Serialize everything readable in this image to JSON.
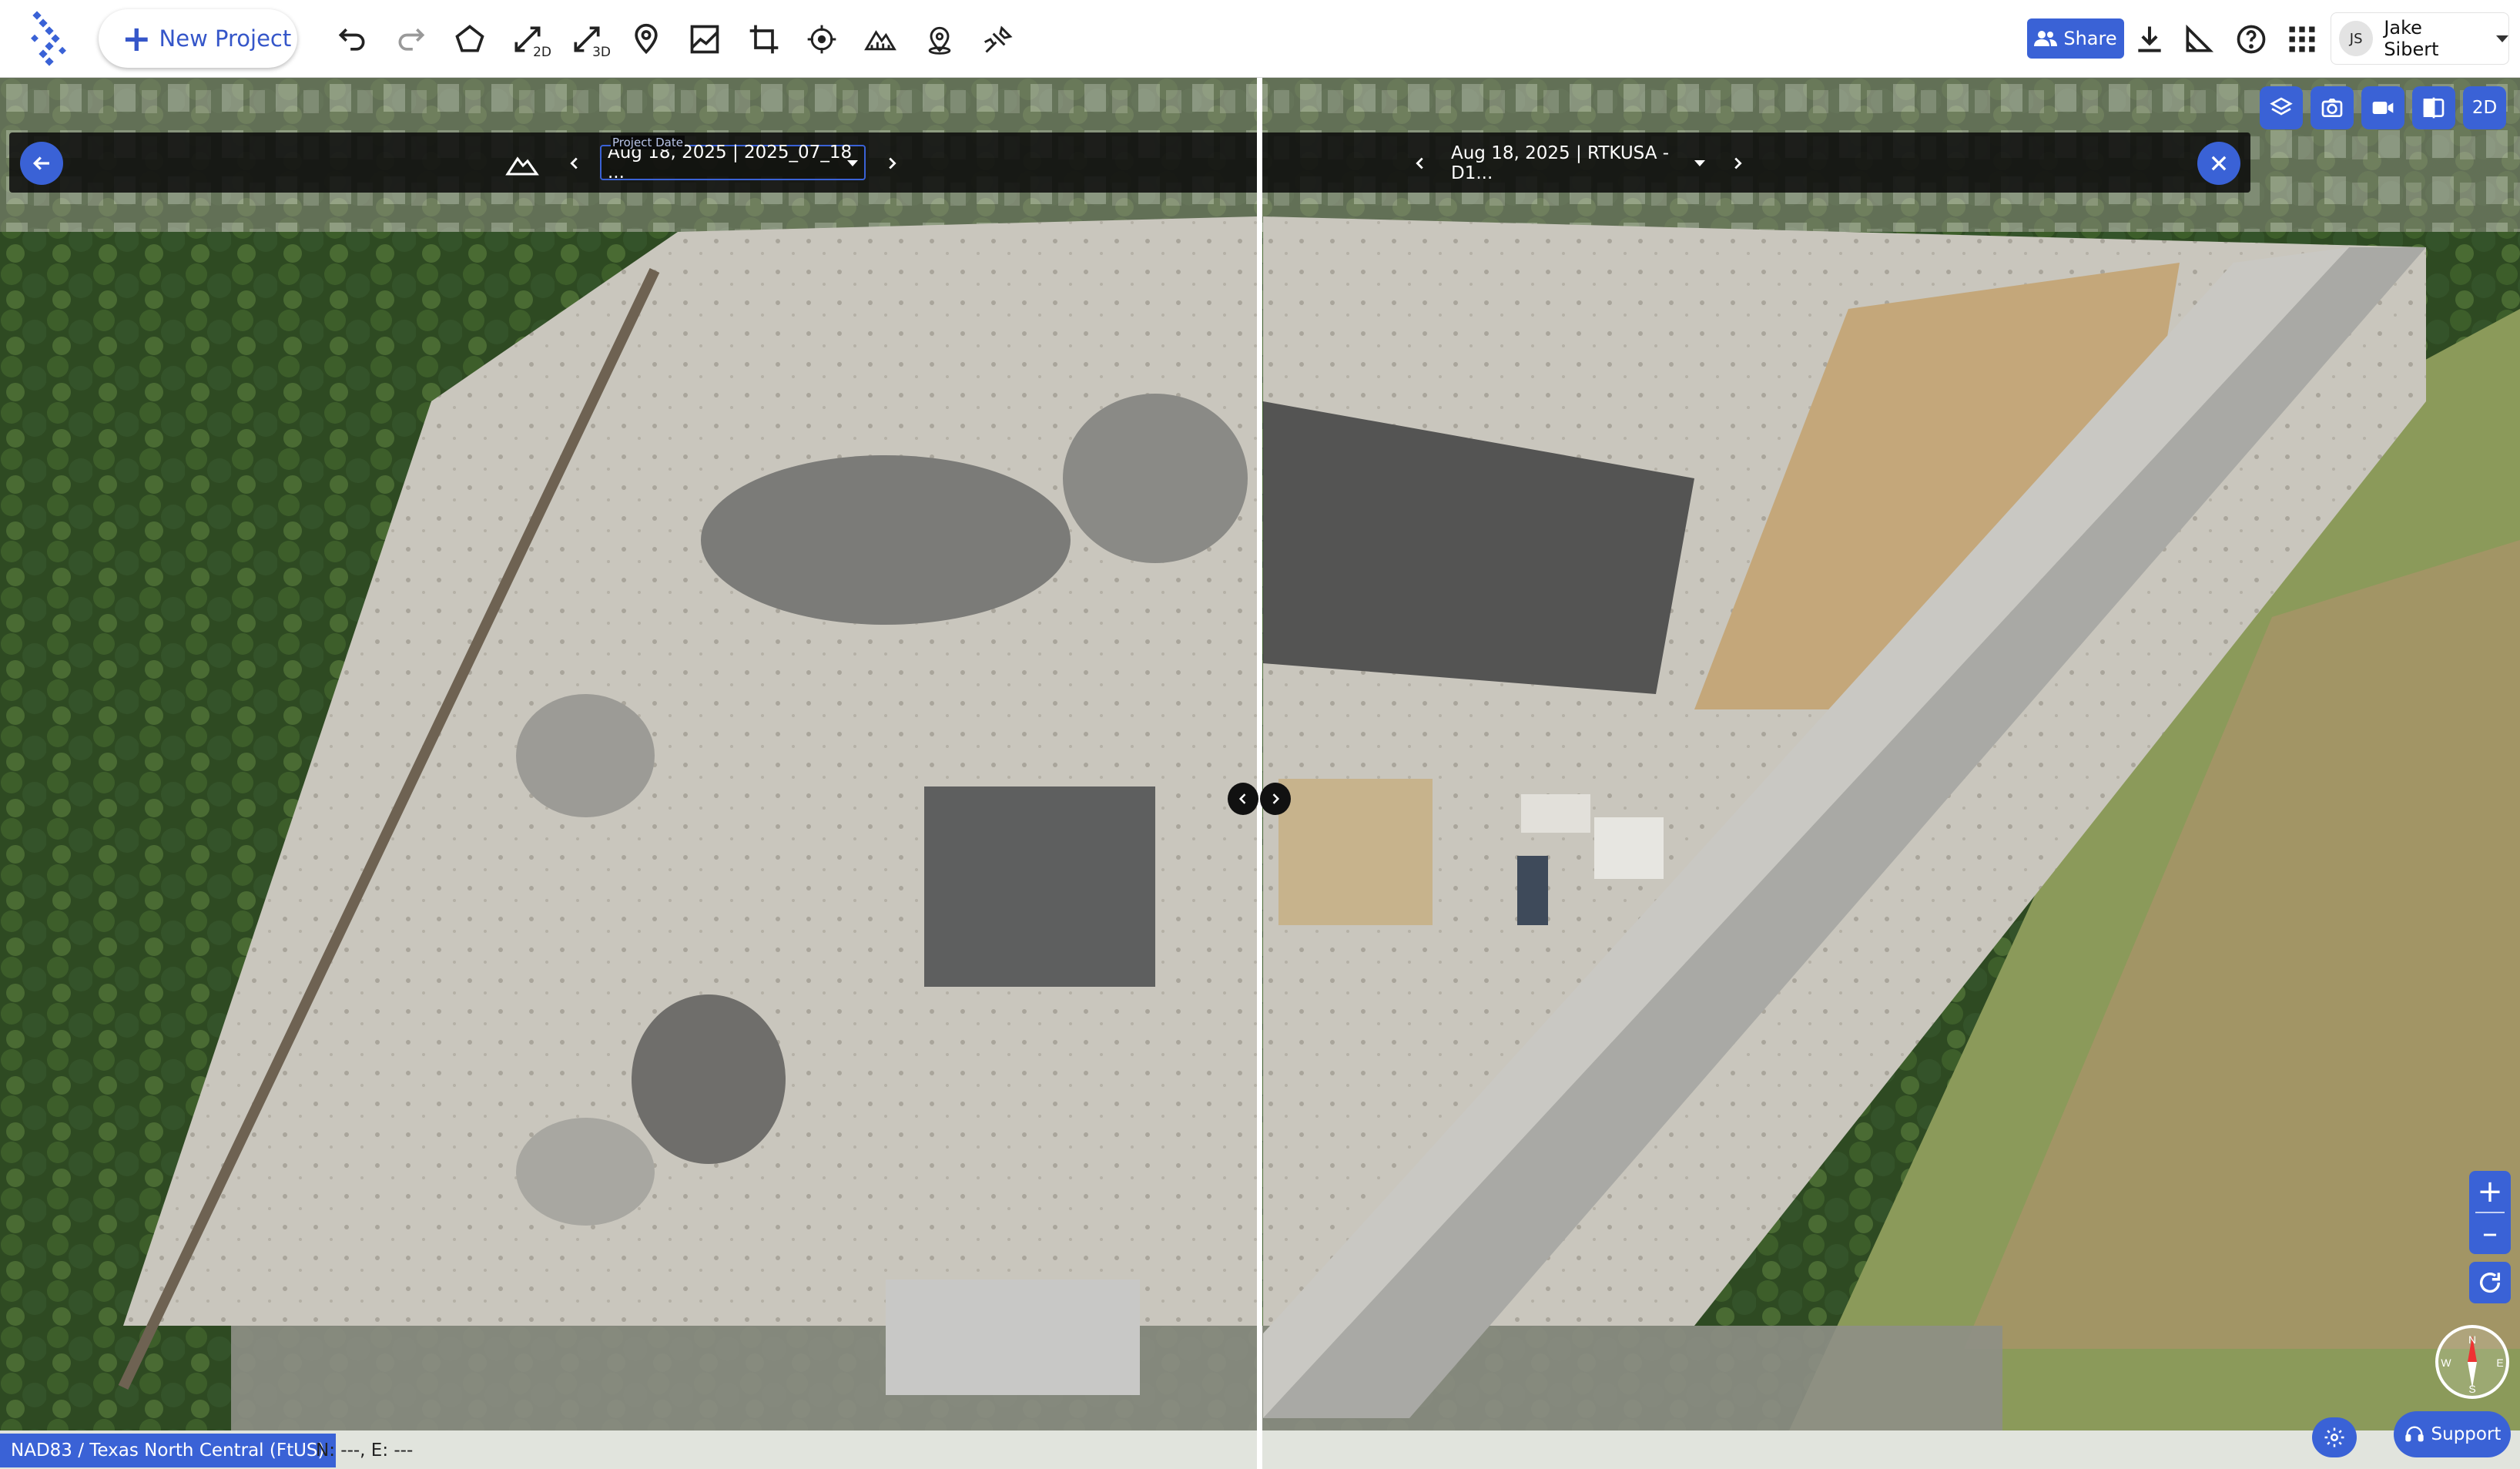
{
  "toolbar": {
    "new_project_label": "New Project",
    "tools": [
      {
        "name": "undo-icon"
      },
      {
        "name": "redo-icon"
      },
      {
        "name": "polygon-icon"
      },
      {
        "name": "measure-2d-icon",
        "sub": "2D"
      },
      {
        "name": "measure-3d-icon",
        "sub": "3D"
      },
      {
        "name": "location-pin-icon"
      },
      {
        "name": "profile-icon"
      },
      {
        "name": "crop-icon"
      },
      {
        "name": "target-icon"
      },
      {
        "name": "volume-icon"
      },
      {
        "name": "gcp-icon"
      },
      {
        "name": "annotation-icon"
      }
    ],
    "share_label": "Share",
    "user_initials": "JS",
    "user_name": "Jake Sibert"
  },
  "compare": {
    "left_field_label": "Project Date",
    "left_date": "Aug 18, 2025 | 2025_07_18 ...",
    "right_date": "Aug 18, 2025 | RTKUSA - D1..."
  },
  "map_controls": {
    "view_mode_label": "2D",
    "zoom_in": "+",
    "zoom_out": "–",
    "compass": {
      "n": "N",
      "s": "S",
      "e": "E",
      "w": "W"
    }
  },
  "statusbar": {
    "crs_label": "NAD83 / Texas North Central (FtUS)",
    "coords_label": "N: ---, E: ---",
    "support_label": "Support"
  },
  "colors": {
    "accent": "#3a62d6",
    "toolbar_bg": "#ffffff",
    "compare_bar_bg": "#0a0a0a"
  }
}
